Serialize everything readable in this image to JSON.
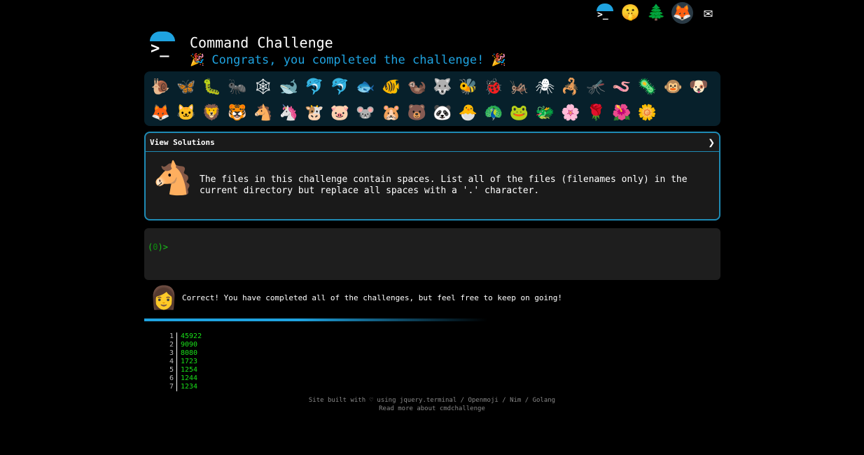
{
  "top_icons": {
    "terminal_label": ">_",
    "ear_glyph": "🤫",
    "tree_glyph": "🌲",
    "gitlab_glyph": "🦊",
    "mail_glyph": "✉"
  },
  "header": {
    "logo_prompt": ">_",
    "title": "Command Challenge",
    "congrats": "🎉 Congrats, you completed the challenge! 🎉"
  },
  "badges": [
    "🐌",
    "🦋",
    "🐛",
    "🐜",
    "🕸",
    "🐋",
    "🐬",
    "🐬",
    "🐟",
    "🐠",
    "🦦",
    "🐺",
    "🐝",
    "🐞",
    "🦗",
    "🕷",
    "🦂",
    "🦟",
    "🪱",
    "🦠",
    "🐵",
    "🐶",
    "🦊",
    "🐱",
    "🦁",
    "🐯",
    "🐴",
    "🦄",
    "🐮",
    "🐷",
    "🐭",
    "🐹",
    "🐻",
    "🐼",
    "🐣",
    "🦚",
    "🐸",
    "🐲",
    "🌸",
    "🌹",
    "🌺",
    "🌼"
  ],
  "challenge": {
    "header_label": "View Solutions",
    "chevron": "❯",
    "horse_glyph": "🐴",
    "text": "The files in this challenge contain spaces. List all of the files (filenames only) in the current directory but replace all spaces with a '.' character."
  },
  "terminal": {
    "prompt_open": "(",
    "count": "0",
    "prompt_close": ")>"
  },
  "feedback": {
    "avatar_glyph": "👩",
    "message": "Correct! You have completed all of the challenges, but feel free to keep on going!"
  },
  "progress": {
    "fraction": 0.45
  },
  "scores": [
    {
      "rank": "1",
      "value": "45922"
    },
    {
      "rank": "2",
      "value": "9090"
    },
    {
      "rank": "3",
      "value": "8080"
    },
    {
      "rank": "4",
      "value": "1723"
    },
    {
      "rank": "5",
      "value": "1254"
    },
    {
      "rank": "6",
      "value": "1244"
    },
    {
      "rank": "7",
      "value": "1234"
    }
  ],
  "footer": {
    "line1": "Site built with ♡ using jquery.terminal / Openmoji / Nim / Golang",
    "line2": "Read more about cmdchallenge"
  },
  "colors": {
    "accent": "#1fa3e0",
    "prompt_green": "#19c419"
  }
}
